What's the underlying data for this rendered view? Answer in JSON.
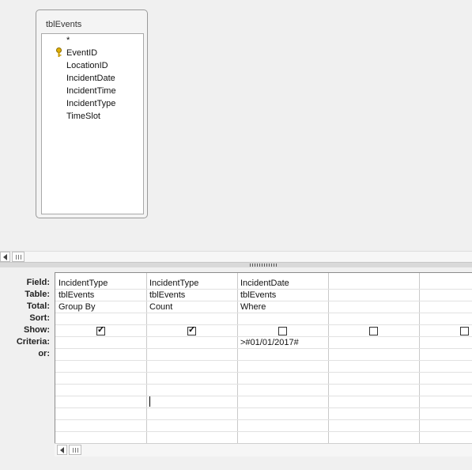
{
  "table_window": {
    "title": "tblEvents",
    "fields": [
      "*",
      "EventID",
      "LocationID",
      "IncidentDate",
      "IncidentTime",
      "IncidentType",
      "TimeSlot"
    ],
    "primary_key_field": "EventID",
    "key_icon": "key-icon"
  },
  "grid": {
    "row_labels": [
      "Field:",
      "Table:",
      "Total:",
      "Sort:",
      "Show:",
      "Criteria:",
      "or:"
    ],
    "columns": [
      {
        "field": "IncidentType",
        "table": "tblEvents",
        "total": "Group By",
        "sort": "",
        "show": true,
        "criteria": ""
      },
      {
        "field": "IncidentType",
        "table": "tblEvents",
        "total": "Count",
        "sort": "",
        "show": true,
        "criteria": ""
      },
      {
        "field": "IncidentDate",
        "table": "tblEvents",
        "total": "Where",
        "sort": "",
        "show": false,
        "criteria": ">#01/01/2017#"
      },
      {
        "field": "",
        "table": "",
        "total": "",
        "sort": "",
        "show": false,
        "criteria": ""
      },
      {
        "field": "",
        "table": "",
        "total": "",
        "sort": "",
        "show": false,
        "criteria": ""
      }
    ]
  },
  "colors": {
    "background": "#f0f0f0",
    "grid_background": "#ffffff",
    "key_icon": "#d9a400"
  }
}
